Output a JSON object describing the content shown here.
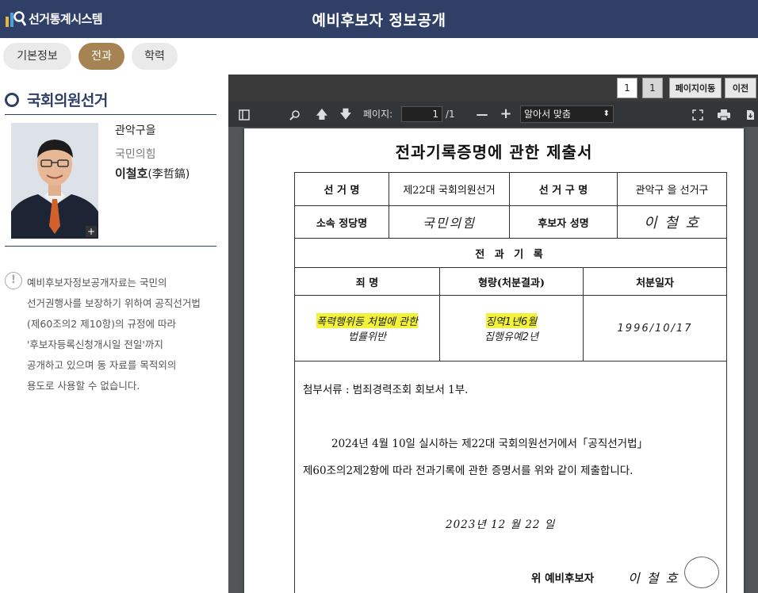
{
  "header": {
    "logo_text": "선거통계시스템",
    "title": "예비후보자 정보공개"
  },
  "tabs": [
    {
      "label": "기본정보",
      "active": false
    },
    {
      "label": "전과",
      "active": true
    },
    {
      "label": "학력",
      "active": false
    }
  ],
  "left": {
    "election": "국회의원선거",
    "candidate": {
      "district": "관악구을",
      "party": "국민의힘",
      "name": "이철호",
      "hanja": "(李哲鎬)"
    },
    "notice_lines": [
      "예비후보자정보공개자료는 국민의",
      "선거권행사를 보장하기 위하여 공직선거법",
      "(제60조의2 제10항)의 규정에 따라",
      "'후보자등록신청개시일 전일'까지",
      "공개하고 있으며 동 자료를 목적외의",
      "용도로 사용할 수 없습니다."
    ]
  },
  "viewer": {
    "topbar": {
      "page_current": "1",
      "page_total": "1",
      "goto_label": "페이지이동",
      "prev_label": "이전"
    },
    "toolbar": {
      "page_label": "페이지:",
      "page_value": "1",
      "page_of": "/1",
      "zoom": "알아서 맞춤"
    },
    "document": {
      "title": "전과기록증명에 관한 제출서",
      "label_election": "선 거 명",
      "value_election": "제22대 국회의원선거",
      "label_district": "선 거 구 명",
      "value_district": "관악구 을 선거구",
      "label_party": "소속 정당명",
      "value_party": "국민의힘",
      "label_name": "후보자 성명",
      "value_name": "이 철 호",
      "section": "전 과 기 록",
      "col_crime": "죄 명",
      "col_penalty": "형량(처분결과)",
      "col_date": "처분일자",
      "crime_line1": "폭력행위등 처벌에 관한",
      "crime_line2": "법률위반",
      "penalty_line1": "징역1년6월",
      "penalty_line2": "집행유예2년",
      "date": "1996/10/17",
      "attachment": "첨부서류 : 범죄경력조회 회보서 1부.",
      "body_line1": "2024년   4월 10일  실시하는  제22대  국회의원선거에서「공직선거법」",
      "body_line2": "제60조의2제2항에  따라  전과기록에  관한  증명서를  위와  같이  제출합니다.",
      "date_signed": "2023년  12  월  22  일",
      "sign_prefix": "위   예비후보자",
      "sign_name": "이 철 호"
    }
  }
}
